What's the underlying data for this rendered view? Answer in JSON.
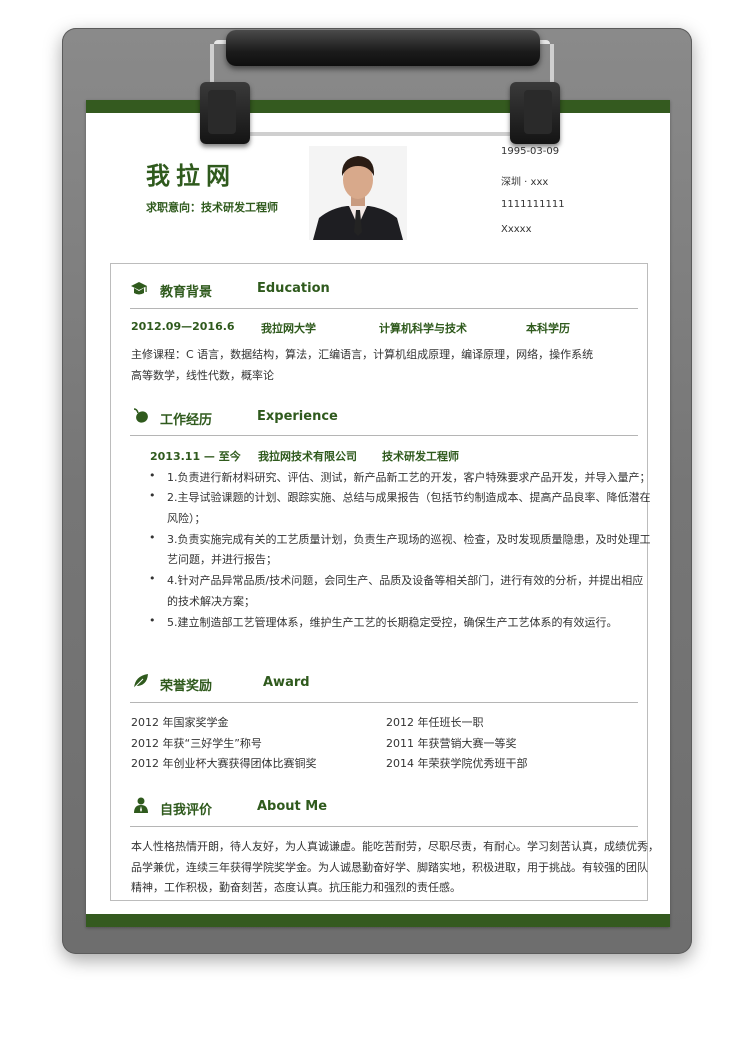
{
  "header": {
    "name": "我拉网",
    "intent": "求职意向：技术研发工程师",
    "birth": "1995-03-09",
    "city": "深圳 · xxx",
    "phone": "1111111111",
    "email": "Xxxxx"
  },
  "education": {
    "title": "教育背景",
    "title_en": "Education",
    "period": "2012.09—2016.6",
    "school": "我拉网大学",
    "major": "计算机科学与技术",
    "degree": "本科学历",
    "courses_line1": "主修课程：C 语言，数据结构，算法，汇编语言，计算机组成原理，编译原理，网络，操作系统",
    "courses_line2": "高等数学，线性代数，概率论"
  },
  "experience": {
    "title": "工作经历",
    "title_en": "Experience",
    "period": "2013.11 — 至今",
    "company": "我拉网技术有限公司",
    "role": "技术研发工程师",
    "lines": [
      "1.负责进行新材料研究、评估、测试，新产品新工艺的开发，客户特殊要求产品开发，并导入量产；",
      "2.主导试验课题的计划、跟踪实施、总结与成果报告（包括节约制造成本、提高产品良率、降低潜在",
      "风险）；",
      "3.负责实施完成有关的工艺质量计划，负责生产现场的巡视、检查，及时发现质量隐患，及时处理工",
      "艺问题，并进行报告；",
      "4.针对产品异常品质/技术问题，会同生产、品质及设备等相关部门，进行有效的分析，并提出相应",
      "的技术解决方案；",
      "5.建立制造部工艺管理体系，维护生产工艺的长期稳定受控，确保生产工艺体系的有效运行。"
    ]
  },
  "award": {
    "title": "荣誉奖励",
    "title_en": "Award",
    "left": [
      "2012 年国家奖学金",
      "2012 年获“三好学生”称号",
      "2012 年创业杯大赛获得团体比赛铜奖"
    ],
    "right": [
      "2012 年任班长一职",
      "2011 年获营销大赛一等奖",
      "2014 年荣获学院优秀班干部"
    ]
  },
  "about": {
    "title": "自我评价",
    "title_en": "About Me",
    "lines": [
      "本人性格热情开朗，待人友好，为人真诚谦虚。能吃苦耐劳，尽职尽责，有耐心。学习刻苦认真，成绩优秀，",
      "品学兼优，连续三年获得学院奖学金。为人诚恳勤奋好学、脚踏实地，积极进取，用于挑战。有较强的团队",
      "精神，工作积极，勤奋刻苦，态度认真。抗压能力和强烈的责任感。"
    ]
  },
  "colors": {
    "accent": "#2f5a1d",
    "bar": "#345a1f",
    "board": "#7a7a7a"
  }
}
